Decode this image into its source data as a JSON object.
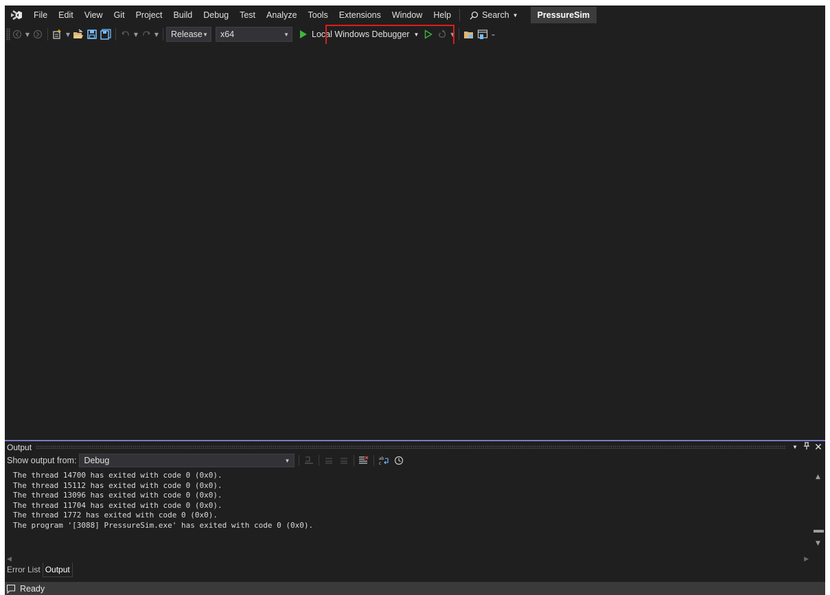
{
  "menu": {
    "items": [
      "File",
      "Edit",
      "View",
      "Git",
      "Project",
      "Build",
      "Debug",
      "Test",
      "Analyze",
      "Tools",
      "Extensions",
      "Window",
      "Help"
    ],
    "search_label": "Search",
    "project_name": "PressureSim"
  },
  "toolbar": {
    "configuration": "Release",
    "platform": "x64",
    "debugger_label": "Local Windows Debugger",
    "accent_green": "#3fb43f",
    "highlight_color": "#e41a1a"
  },
  "output": {
    "title": "Output",
    "show_from_label": "Show output from:",
    "source": "Debug",
    "lines": [
      "The thread 14700 has exited with code 0 (0x0).",
      "The thread 15112 has exited with code 0 (0x0).",
      "The thread 13096 has exited with code 0 (0x0).",
      "The thread 11704 has exited with code 0 (0x0).",
      "The thread 1772 has exited with code 0 (0x0).",
      "The program '[3088] PressureSim.exe' has exited with code 0 (0x0)."
    ]
  },
  "bottom_tabs": [
    "Error List",
    "Output"
  ],
  "status": {
    "text": "Ready"
  }
}
